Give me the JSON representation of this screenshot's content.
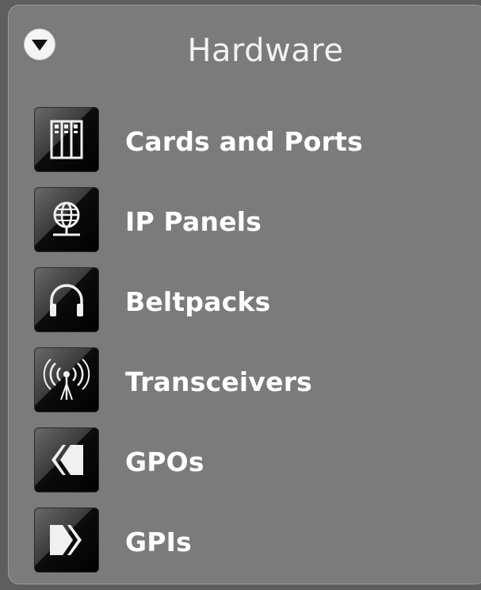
{
  "section": {
    "title": "Hardware",
    "collapse_icon": "chevron-down-circle-icon"
  },
  "items": [
    {
      "label": "Cards and Ports",
      "icon": "cards-rack-icon"
    },
    {
      "label": "IP Panels",
      "icon": "globe-network-icon"
    },
    {
      "label": "Beltpacks",
      "icon": "headset-icon"
    },
    {
      "label": "Transceivers",
      "icon": "antenna-signal-icon"
    },
    {
      "label": "GPOs",
      "icon": "arrow-left-icon"
    },
    {
      "label": "GPIs",
      "icon": "arrow-right-icon"
    }
  ],
  "colors": {
    "panel_bg": "#7b7b7b",
    "outer_bg": "#5e5e5e",
    "text": "#ffffff"
  }
}
